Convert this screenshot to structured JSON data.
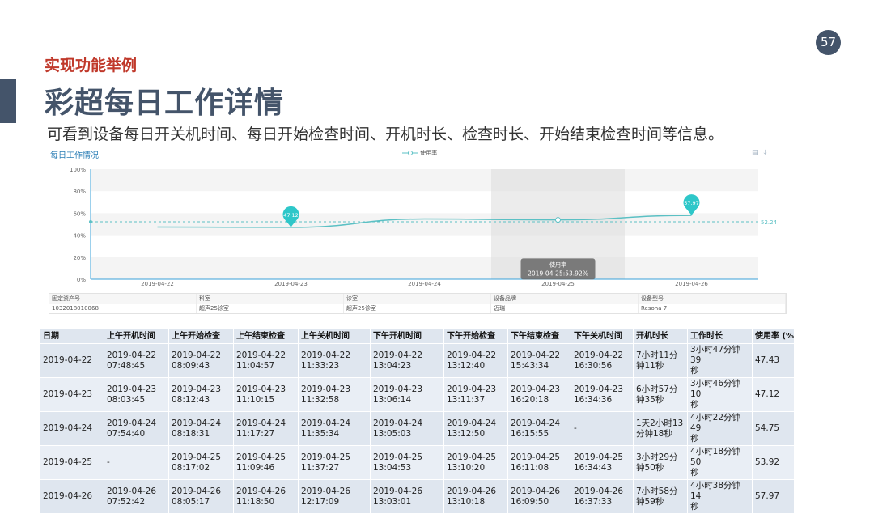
{
  "page_number": "57",
  "section_label": "实现功能举例",
  "title": "彩超每日工作详情",
  "subtitle": "可看到设备每日开关机时间、每日开始检查时间、开机时长、检查时长、开始结束检查时间等信息。",
  "chart_panel": {
    "title": "每日工作情况",
    "legend": "使用率",
    "tool_icons": [
      "data-view-icon",
      "download-icon"
    ]
  },
  "chart_data": {
    "type": "line",
    "x": [
      "2019-04-22",
      "2019-04-23",
      "2019-04-24",
      "2019-04-25",
      "2019-04-26"
    ],
    "series": [
      {
        "name": "使用率",
        "values": [
          47.43,
          47.12,
          54.75,
          53.92,
          57.97
        ]
      }
    ],
    "ylim": [
      0,
      100
    ],
    "yticks": [
      "0%",
      "20%",
      "40%",
      "60%",
      "80%",
      "100%"
    ],
    "markpoints": [
      {
        "x": "2019-04-23",
        "label": "47.12"
      },
      {
        "x": "2019-04-26",
        "label": "57.97"
      }
    ],
    "markline": {
      "value": 52.24,
      "label": "52.24"
    },
    "tooltip": {
      "x": "2019-04-25",
      "title": "使用率",
      "text": "2019-04-25:53.92%"
    },
    "colors": {
      "line": "#5bc0c4",
      "marker": "#2ec7c9",
      "axis": "#3aa0d8"
    }
  },
  "info_table": {
    "headers": [
      "固定资产号",
      "科室",
      "诊室",
      "设备品牌",
      "设备型号"
    ],
    "values": [
      "1032018010068",
      "超声25诊室",
      "超声25诊室",
      "迈瑞",
      "Resona 7"
    ]
  },
  "data_table": {
    "headers": [
      "日期",
      "上午开机时间",
      "上午开始检查",
      "上午结束检查",
      "上午关机时间",
      "下午开机时间",
      "下午开始检查",
      "下午结束检查",
      "下午关机时间",
      "开机时长",
      "工作时长",
      "使用率 (%)"
    ],
    "rows": [
      [
        "2019-04-22",
        "2019-04-22\n07:48:45",
        "2019-04-22\n08:09:43",
        "2019-04-22\n11:04:57",
        "2019-04-22\n11:33:23",
        "2019-04-22\n13:04:23",
        "2019-04-22\n13:12:40",
        "2019-04-22\n15:43:34",
        "2019-04-22\n16:30:56",
        "7小时11分\n钟11秒",
        "3小时47分钟39\n秒",
        "47.43"
      ],
      [
        "2019-04-23",
        "2019-04-23\n08:03:45",
        "2019-04-23\n08:12:43",
        "2019-04-23\n11:10:15",
        "2019-04-23\n11:32:58",
        "2019-04-23\n13:06:14",
        "2019-04-23\n13:11:37",
        "2019-04-23\n16:20:18",
        "2019-04-23\n16:34:36",
        "6小时57分\n钟35秒",
        "3小时46分钟10\n秒",
        "47.12"
      ],
      [
        "2019-04-24",
        "2019-04-24\n07:54:40",
        "2019-04-24\n08:18:31",
        "2019-04-24\n11:17:27",
        "2019-04-24\n11:35:34",
        "2019-04-24\n13:05:03",
        "2019-04-24\n13:12:50",
        "2019-04-24\n16:15:55",
        "-",
        "1天2小时13\n分钟18秒",
        "4小时22分钟49\n秒",
        "54.75"
      ],
      [
        "2019-04-25",
        "-",
        "2019-04-25\n08:17:02",
        "2019-04-25\n11:09:46",
        "2019-04-25\n11:37:27",
        "2019-04-25\n13:04:53",
        "2019-04-25\n13:10:20",
        "2019-04-25\n16:11:08",
        "2019-04-25\n16:34:43",
        "3小时29分\n钟50秒",
        "4小时18分钟50\n秒",
        "53.92"
      ],
      [
        "2019-04-26",
        "2019-04-26\n07:52:42",
        "2019-04-26\n08:05:17",
        "2019-04-26\n11:18:50",
        "2019-04-26\n12:17:09",
        "2019-04-26\n13:03:01",
        "2019-04-26\n13:10:18",
        "2019-04-26\n16:09:50",
        "2019-04-26\n16:37:33",
        "7小时58分\n钟59秒",
        "4小时38分钟14\n秒",
        "57.97"
      ]
    ]
  }
}
